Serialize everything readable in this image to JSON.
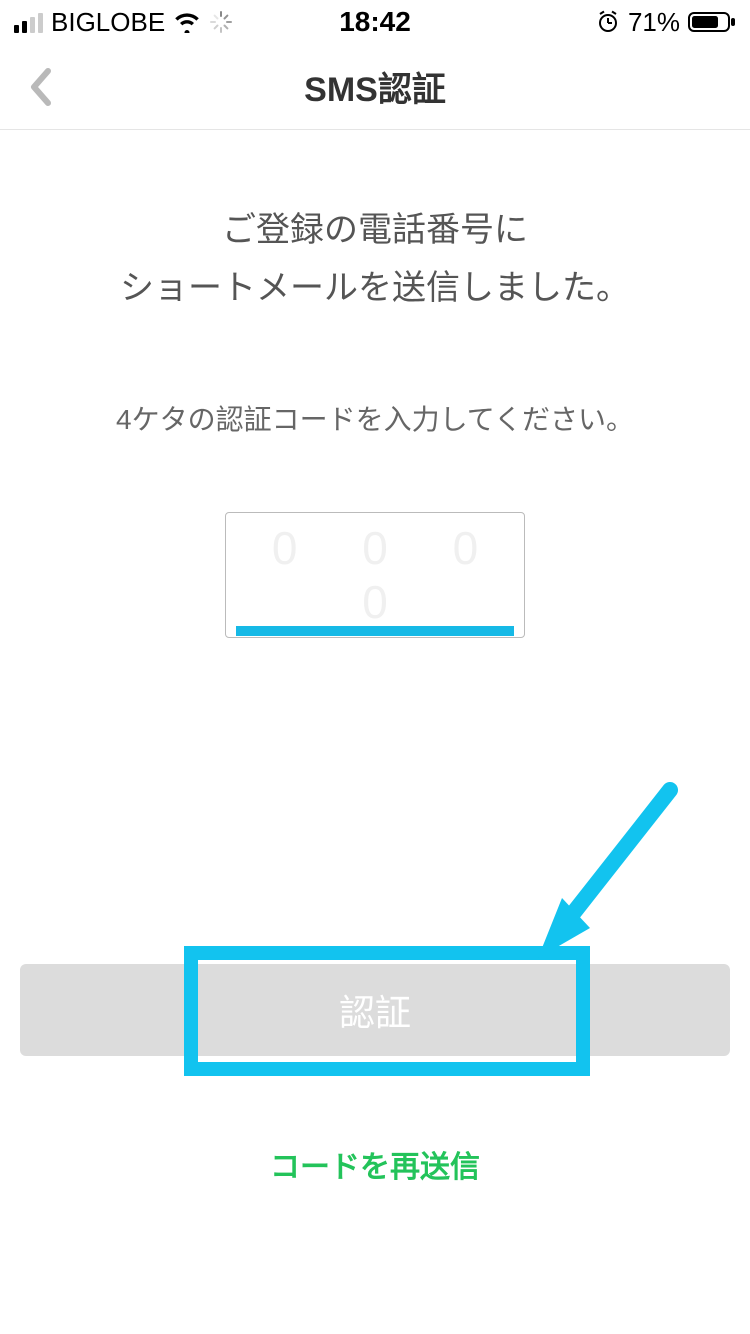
{
  "status": {
    "carrier": "BIGLOBE",
    "time": "18:42",
    "battery": "71%"
  },
  "nav": {
    "title": "SMS認証"
  },
  "lead_line1": "ご登録の電話番号に",
  "lead_line2": "ショートメールを送信しました。",
  "sub": "4ケタの認証コードを入力してください。",
  "code_placeholder": "0 0 0 0",
  "submit_label": "認証",
  "resend_label": "コードを再送信"
}
